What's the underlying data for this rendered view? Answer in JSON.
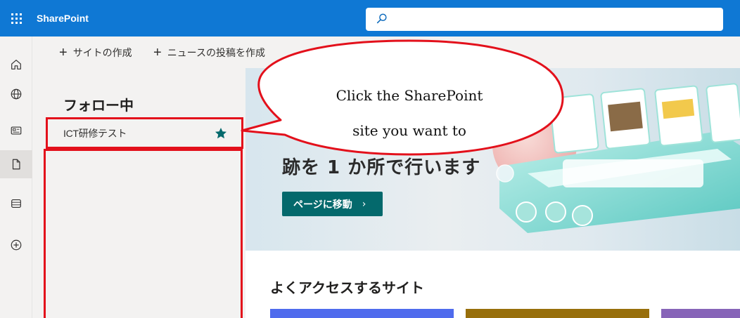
{
  "app": {
    "name": "SharePoint"
  },
  "search": {
    "placeholder": ""
  },
  "rail": {
    "items": [
      {
        "name": "home-icon"
      },
      {
        "name": "globe-icon"
      },
      {
        "name": "news-icon"
      },
      {
        "name": "document-icon"
      },
      {
        "name": "list-icon"
      },
      {
        "name": "add-circle-icon"
      }
    ]
  },
  "commands": {
    "create_site": "サイトの作成",
    "create_news": "ニュースの投稿を作成"
  },
  "following": {
    "heading": "フォロー中",
    "sites": [
      {
        "label": "ICT研修テスト"
      }
    ]
  },
  "hero": {
    "text": "跡を 1 か所で行います",
    "button_label": "ページに移動",
    "button_chevron": "›"
  },
  "frequent": {
    "title": "よくアクセスするサイト"
  },
  "callout": {
    "line1": "Click the SharePoint",
    "line2": "site you want to"
  },
  "colors": {
    "suitebar": "#0f78d4",
    "highlight": "#e3101b",
    "accent": "#04696c",
    "star": "#04696c",
    "card1": "#4f6bed",
    "card2": "#986f0b",
    "card3": "#8764b8"
  }
}
